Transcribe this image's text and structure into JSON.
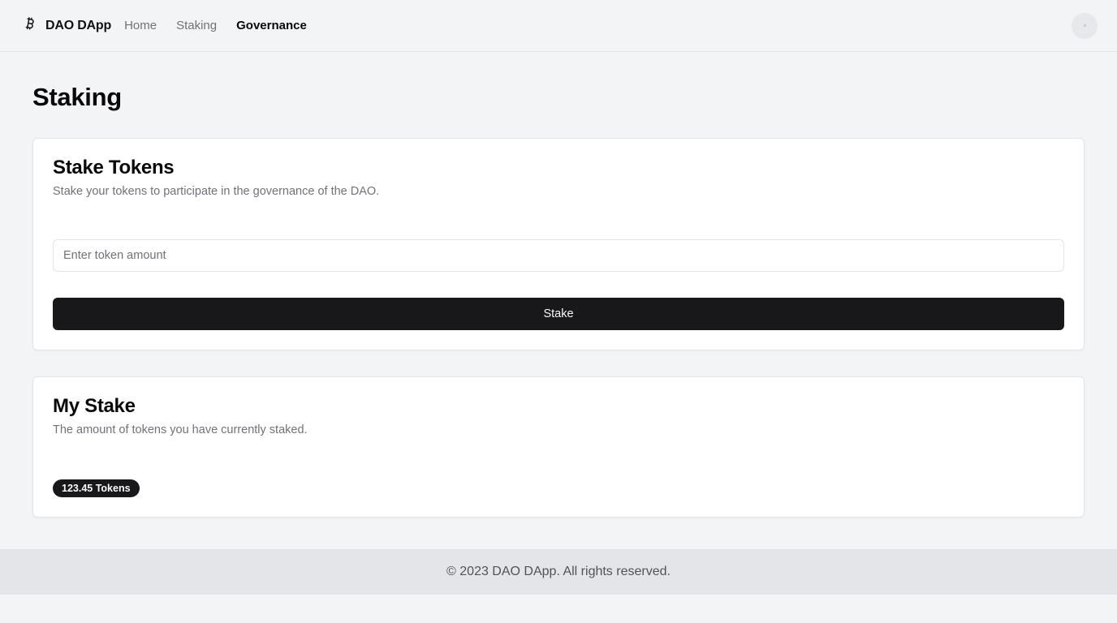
{
  "header": {
    "brand": "DAO DApp",
    "brand_icon": "bitcoin-icon",
    "nav": [
      {
        "label": "Home",
        "active": false
      },
      {
        "label": "Staking",
        "active": false
      },
      {
        "label": "Governance",
        "active": true
      }
    ],
    "avatar_icon": "avatar-icon"
  },
  "page": {
    "title": "Staking"
  },
  "stake_card": {
    "title": "Stake Tokens",
    "description": "Stake your tokens to participate in the governance of the DAO.",
    "input_placeholder": "Enter token amount",
    "input_value": "",
    "button_label": "Stake"
  },
  "my_stake_card": {
    "title": "My Stake",
    "description": "The amount of tokens you have currently staked.",
    "badge": "123.45 Tokens"
  },
  "footer": {
    "text": "© 2023 DAO DApp. All rights reserved."
  },
  "colors": {
    "background": "#f3f4f6",
    "primary": "#18181b",
    "muted_text": "#71717a",
    "footer_bg": "#e4e5e8"
  }
}
